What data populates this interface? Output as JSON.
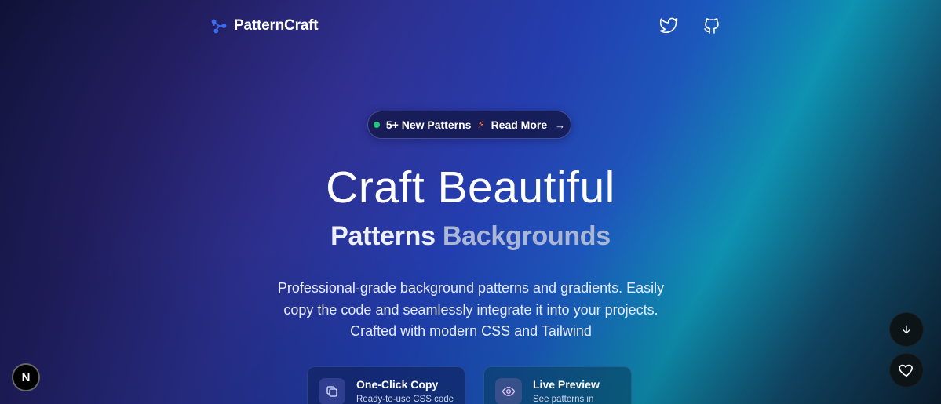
{
  "brand": {
    "name": "PatternCraft",
    "logo_icon": "share-nodes-icon"
  },
  "nav": {
    "social": [
      {
        "name": "twitter-icon"
      },
      {
        "name": "github-icon"
      }
    ]
  },
  "announcement": {
    "text": "5+ New Patterns",
    "link": "Read More",
    "dot_color": "#22c57a",
    "bolt_color": "#f0702a"
  },
  "hero": {
    "title": "Craft Beautiful",
    "subtitle_part1": "Patterns",
    "subtitle_part2": "Backgrounds",
    "description_line1": "Professional-grade background patterns and gradients. Easily",
    "description_line2": "copy the code and seamlessly integrate it into your projects.",
    "description_line3": "Crafted with modern CSS and Tailwind"
  },
  "features": [
    {
      "title": "One-Click Copy",
      "subtitle": "Ready-to-use CSS code",
      "icon": "copy-icon"
    },
    {
      "title": "Live Preview",
      "subtitle": "See patterns in action",
      "icon": "eye-icon"
    }
  ],
  "badge": {
    "letter": "N"
  },
  "fabs": {
    "down": "arrow-down-icon",
    "favorite": "heart-icon"
  }
}
